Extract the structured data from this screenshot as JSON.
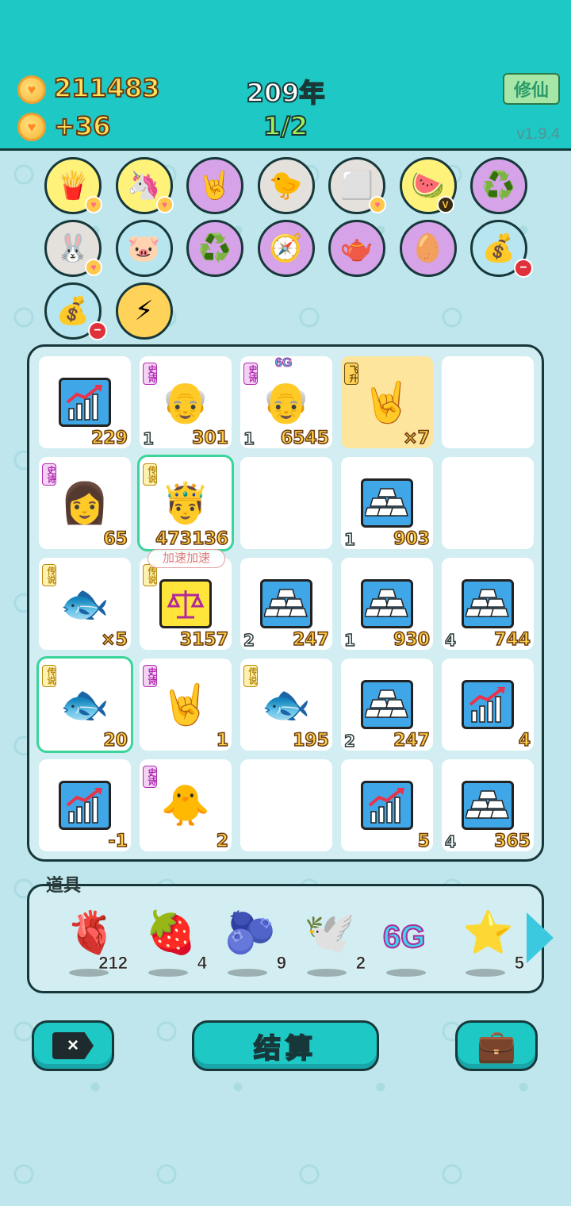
{
  "header": {
    "coins": "211483",
    "income": "+36",
    "year": "209年",
    "progress": "1/2",
    "xiuxian_label": "修仙",
    "version": "v1.9.4"
  },
  "skills": [
    {
      "icon": "fries-icon",
      "glyph": "🍟",
      "bg": "#fff27a",
      "badge": "heart"
    },
    {
      "icon": "unicorn-icon",
      "glyph": "🦄",
      "bg": "#fff27a",
      "badge": "heart"
    },
    {
      "icon": "rock-hand-icon",
      "glyph": "🤘",
      "bg": "#d6a2e8",
      "badge": ""
    },
    {
      "icon": "chick-egg-icon",
      "glyph": "🐤",
      "bg": "#e4e0dc",
      "badge": ""
    },
    {
      "icon": "sugar-cube-icon",
      "glyph": "⬜",
      "bg": "#e4e0dc",
      "badge": "heart"
    },
    {
      "icon": "fruit-bowl-icon",
      "glyph": "🍉",
      "bg": "#fff27a",
      "badge": "v"
    },
    {
      "icon": "recycle-icon",
      "glyph": "♻️",
      "bg": "#d6a2e8",
      "badge": ""
    },
    {
      "icon": "bunny-icon",
      "glyph": "🐰",
      "bg": "#e4e0dc",
      "badge": "heart"
    },
    {
      "icon": "piggy-bank-icon",
      "glyph": "🐷",
      "bg": "#b7e6f0",
      "badge": ""
    },
    {
      "icon": "recycle-icon",
      "glyph": "♻️",
      "bg": "#d6a2e8",
      "badge": ""
    },
    {
      "icon": "compass-icon",
      "glyph": "🧭",
      "bg": "#d6a2e8",
      "badge": ""
    },
    {
      "icon": "gravy-boat-icon",
      "glyph": "🫖",
      "bg": "#d6a2e8",
      "badge": ""
    },
    {
      "icon": "egg-face-icon",
      "glyph": "🥚",
      "bg": "#d6a2e8",
      "badge": ""
    },
    {
      "icon": "money-bag-icon",
      "glyph": "💰",
      "bg": "#b7e6f0",
      "badge": "minus"
    },
    {
      "icon": "money-bag-icon",
      "glyph": "💰",
      "bg": "#b7e6f0",
      "badge": "minus"
    },
    {
      "icon": "lightning-icon",
      "glyph": "⚡",
      "bg": "#ffd25a",
      "badge": ""
    }
  ],
  "board": {
    "cells": [
      {
        "icon": "chart-icon",
        "kind": "chart",
        "tag": "",
        "tag_label": "",
        "lvl": "",
        "num": "229",
        "hl": false,
        "sel": false
      },
      {
        "icon": "old-man-icon",
        "kind": "emoji",
        "glyph": "👴",
        "tag": "epic",
        "tag_label": "史诗",
        "lvl": "1",
        "num": "301",
        "hl": false,
        "sel": false
      },
      {
        "icon": "old-man-icon",
        "kind": "emoji",
        "glyph": "👴",
        "tag": "epic",
        "tag_label": "史诗",
        "lvl": "1",
        "num": "6545",
        "hl": false,
        "sel": false,
        "extra": "6G"
      },
      {
        "icon": "rock-hand-icon",
        "kind": "emoji",
        "glyph": "🤘",
        "tag": "fly",
        "tag_label": "飞升",
        "lvl": "",
        "num": "×7",
        "hl": true,
        "sel": false
      },
      {
        "icon": "",
        "kind": "empty",
        "tag": "",
        "tag_label": "",
        "lvl": "",
        "num": "",
        "hl": false,
        "sel": false
      },
      {
        "icon": "girl-icon",
        "kind": "emoji",
        "glyph": "👩",
        "tag": "epic",
        "tag_label": "史诗",
        "lvl": "",
        "num": "65",
        "hl": false,
        "sel": false
      },
      {
        "icon": "king-icon",
        "kind": "emoji",
        "glyph": "🤴",
        "tag": "legend",
        "tag_label": "传说",
        "lvl": "",
        "num": "473136",
        "hl": false,
        "sel": true
      },
      {
        "icon": "",
        "kind": "empty",
        "tag": "",
        "tag_label": "",
        "lvl": "",
        "num": "",
        "hl": false,
        "sel": false
      },
      {
        "icon": "gold-bars-icon",
        "kind": "gold",
        "tag": "",
        "tag_label": "",
        "lvl": "1",
        "num": "903",
        "hl": false,
        "sel": false
      },
      {
        "icon": "",
        "kind": "empty",
        "tag": "",
        "tag_label": "",
        "lvl": "",
        "num": "",
        "hl": false,
        "sel": false
      },
      {
        "icon": "koi-fish-icon",
        "kind": "emoji",
        "glyph": "🐟",
        "tag": "legend",
        "tag_label": "传说",
        "lvl": "",
        "num": "×5",
        "hl": false,
        "sel": false
      },
      {
        "icon": "scale-icon",
        "kind": "scale",
        "tag": "legend",
        "tag_label": "传说",
        "lvl": "",
        "num": "3157",
        "hl": false,
        "sel": false
      },
      {
        "icon": "gold-bars-icon",
        "kind": "gold",
        "tag": "",
        "tag_label": "",
        "lvl": "2",
        "num": "247",
        "hl": false,
        "sel": false
      },
      {
        "icon": "gold-bars-icon",
        "kind": "gold",
        "tag": "",
        "tag_label": "",
        "lvl": "1",
        "num": "930",
        "hl": false,
        "sel": false
      },
      {
        "icon": "gold-bars-icon",
        "kind": "gold",
        "tag": "",
        "tag_label": "",
        "lvl": "4",
        "num": "744",
        "hl": false,
        "sel": false
      },
      {
        "icon": "koi-fish-icon",
        "kind": "emoji",
        "glyph": "🐟",
        "tag": "legend",
        "tag_label": "传说",
        "lvl": "",
        "num": "20",
        "hl": false,
        "sel": true
      },
      {
        "icon": "rock-hand-icon",
        "kind": "emoji",
        "glyph": "🤘",
        "tag": "epic",
        "tag_label": "史诗",
        "lvl": "",
        "num": "1",
        "hl": false,
        "sel": false
      },
      {
        "icon": "koi-fish-icon",
        "kind": "emoji",
        "glyph": "🐟",
        "tag": "legend",
        "tag_label": "传说",
        "lvl": "",
        "num": "195",
        "hl": false,
        "sel": false
      },
      {
        "icon": "gold-bars-icon",
        "kind": "gold",
        "tag": "",
        "tag_label": "",
        "lvl": "2",
        "num": "247",
        "hl": false,
        "sel": false
      },
      {
        "icon": "chart-icon",
        "kind": "chart",
        "tag": "",
        "tag_label": "",
        "lvl": "",
        "num": "4",
        "hl": false,
        "sel": false
      },
      {
        "icon": "chart-icon",
        "kind": "chart",
        "tag": "",
        "tag_label": "",
        "lvl": "",
        "num": "-1",
        "hl": false,
        "sel": false
      },
      {
        "icon": "chick-icon",
        "kind": "emoji",
        "glyph": "🐥",
        "tag": "epic",
        "tag_label": "史诗",
        "lvl": "",
        "num": "2",
        "hl": false,
        "sel": false
      },
      {
        "icon": "",
        "kind": "empty",
        "tag": "",
        "tag_label": "",
        "lvl": "",
        "num": "",
        "hl": false,
        "sel": false
      },
      {
        "icon": "chart-icon",
        "kind": "chart",
        "tag": "",
        "tag_label": "",
        "lvl": "",
        "num": "5",
        "hl": false,
        "sel": false
      },
      {
        "icon": "gold-bars-icon",
        "kind": "gold",
        "tag": "",
        "tag_label": "",
        "lvl": "4",
        "num": "365",
        "hl": false,
        "sel": false
      }
    ],
    "speedup_label": "加速加速"
  },
  "items": {
    "title": "道具",
    "list": [
      {
        "icon": "liver-icon",
        "glyph": "🫀",
        "count": "212"
      },
      {
        "icon": "bayberry-icon",
        "glyph": "🍓",
        "count": "4"
      },
      {
        "icon": "blueberry-icon",
        "glyph": "🫐",
        "count": "9"
      },
      {
        "icon": "pigeon-icon",
        "glyph": "🕊️",
        "count": "2"
      },
      {
        "icon": "6g-icon",
        "glyph": "6G",
        "count": ""
      },
      {
        "icon": "star-icon",
        "glyph": "⭐",
        "count": "5"
      }
    ]
  },
  "buttons": {
    "close_label": "×",
    "settle_label": "结算",
    "bag_glyph": "💼"
  }
}
